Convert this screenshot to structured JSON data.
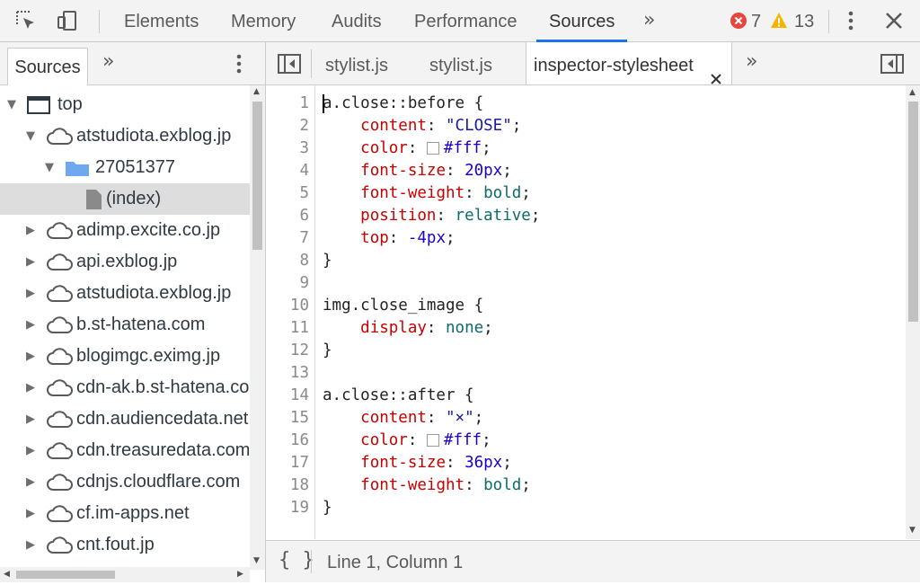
{
  "toolbar": {
    "tabs": [
      {
        "label": "Elements"
      },
      {
        "label": "Memory"
      },
      {
        "label": "Audits"
      },
      {
        "label": "Performance"
      },
      {
        "label": "Sources"
      }
    ],
    "active_tab": "Sources",
    "more_tabs_icon": "double-chevron-right-icon",
    "errors_count": "7",
    "warnings_count": "13",
    "colors": {
      "accent": "#1a73e8",
      "error": "#e8453c",
      "warning": "#f4b400"
    }
  },
  "navigator": {
    "tab_label": "Sources",
    "tree": [
      {
        "label": "top",
        "type": "frame",
        "expanded": true
      },
      {
        "label": "atstudiota.exblog.jp",
        "type": "domain",
        "expanded": true
      },
      {
        "label": "27051377",
        "type": "folder",
        "expanded": true
      },
      {
        "label": "(index)",
        "type": "file",
        "selected": true
      },
      {
        "label": "adimp.excite.co.jp",
        "type": "domain",
        "expanded": false
      },
      {
        "label": "api.exblog.jp",
        "type": "domain",
        "expanded": false
      },
      {
        "label": "atstudiota.exblog.jp",
        "type": "domain",
        "expanded": false
      },
      {
        "label": "b.st-hatena.com",
        "type": "domain",
        "expanded": false
      },
      {
        "label": "blogimgc.eximg.jp",
        "type": "domain",
        "expanded": false
      },
      {
        "label": "cdn-ak.b.st-hatena.com",
        "type": "domain",
        "expanded": false
      },
      {
        "label": "cdn.audiencedata.net",
        "type": "domain",
        "expanded": false
      },
      {
        "label": "cdn.treasuredata.com",
        "type": "domain",
        "expanded": false
      },
      {
        "label": "cdnjs.cloudflare.com",
        "type": "domain",
        "expanded": false
      },
      {
        "label": "cf.im-apps.net",
        "type": "domain",
        "expanded": false
      },
      {
        "label": "cnt.fout.jp",
        "type": "domain",
        "expanded": false
      }
    ]
  },
  "editor": {
    "tabs": [
      {
        "label": "stylist.js"
      },
      {
        "label": "stylist.js"
      },
      {
        "label": "inspector-stylesheet",
        "active": true
      }
    ],
    "lines": [
      [
        [
          "t-sel",
          "a.close::before "
        ],
        [
          "t-punct",
          "{"
        ]
      ],
      [
        [
          "t-punct",
          "    "
        ],
        [
          "t-prop",
          "content"
        ],
        [
          "t-punct",
          ": "
        ],
        [
          "t-str",
          "\"CLOSE\""
        ],
        [
          "t-punct",
          ";"
        ]
      ],
      [
        [
          "t-punct",
          "    "
        ],
        [
          "t-prop",
          "color"
        ],
        [
          "t-punct",
          ": "
        ],
        [
          "swatch",
          "#ffffff"
        ],
        [
          "t-num",
          "#fff"
        ],
        [
          "t-punct",
          ";"
        ]
      ],
      [
        [
          "t-punct",
          "    "
        ],
        [
          "t-prop",
          "font-size"
        ],
        [
          "t-punct",
          ": "
        ],
        [
          "t-num",
          "20px"
        ],
        [
          "t-punct",
          ";"
        ]
      ],
      [
        [
          "t-punct",
          "    "
        ],
        [
          "t-prop",
          "font-weight"
        ],
        [
          "t-punct",
          ": "
        ],
        [
          "t-kw",
          "bold"
        ],
        [
          "t-punct",
          ";"
        ]
      ],
      [
        [
          "t-punct",
          "    "
        ],
        [
          "t-prop",
          "position"
        ],
        [
          "t-punct",
          ": "
        ],
        [
          "t-kw",
          "relative"
        ],
        [
          "t-punct",
          ";"
        ]
      ],
      [
        [
          "t-punct",
          "    "
        ],
        [
          "t-prop",
          "top"
        ],
        [
          "t-punct",
          ": "
        ],
        [
          "t-num",
          "-4px"
        ],
        [
          "t-punct",
          ";"
        ]
      ],
      [
        [
          "t-punct",
          "}"
        ]
      ],
      [],
      [
        [
          "t-sel",
          "img.close_image "
        ],
        [
          "t-punct",
          "{"
        ]
      ],
      [
        [
          "t-punct",
          "    "
        ],
        [
          "t-prop",
          "display"
        ],
        [
          "t-punct",
          ": "
        ],
        [
          "t-kw",
          "none"
        ],
        [
          "t-punct",
          ";"
        ]
      ],
      [
        [
          "t-punct",
          "}"
        ]
      ],
      [],
      [
        [
          "t-sel",
          "a.close::after "
        ],
        [
          "t-punct",
          "{"
        ]
      ],
      [
        [
          "t-punct",
          "    "
        ],
        [
          "t-prop",
          "content"
        ],
        [
          "t-punct",
          ": "
        ],
        [
          "t-str",
          "\"×\""
        ],
        [
          "t-punct",
          ";"
        ]
      ],
      [
        [
          "t-punct",
          "    "
        ],
        [
          "t-prop",
          "color"
        ],
        [
          "t-punct",
          ": "
        ],
        [
          "swatch",
          "#ffffff"
        ],
        [
          "t-num",
          "#fff"
        ],
        [
          "t-punct",
          ";"
        ]
      ],
      [
        [
          "t-punct",
          "    "
        ],
        [
          "t-prop",
          "font-size"
        ],
        [
          "t-punct",
          ": "
        ],
        [
          "t-num",
          "36px"
        ],
        [
          "t-punct",
          ";"
        ]
      ],
      [
        [
          "t-punct",
          "    "
        ],
        [
          "t-prop",
          "font-weight"
        ],
        [
          "t-punct",
          ": "
        ],
        [
          "t-kw",
          "bold"
        ],
        [
          "t-punct",
          ";"
        ]
      ],
      [
        [
          "t-punct",
          "}"
        ]
      ]
    ]
  },
  "statusbar": {
    "pretty_print_label": "{ }",
    "cursor_position": "Line 1, Column 1"
  }
}
